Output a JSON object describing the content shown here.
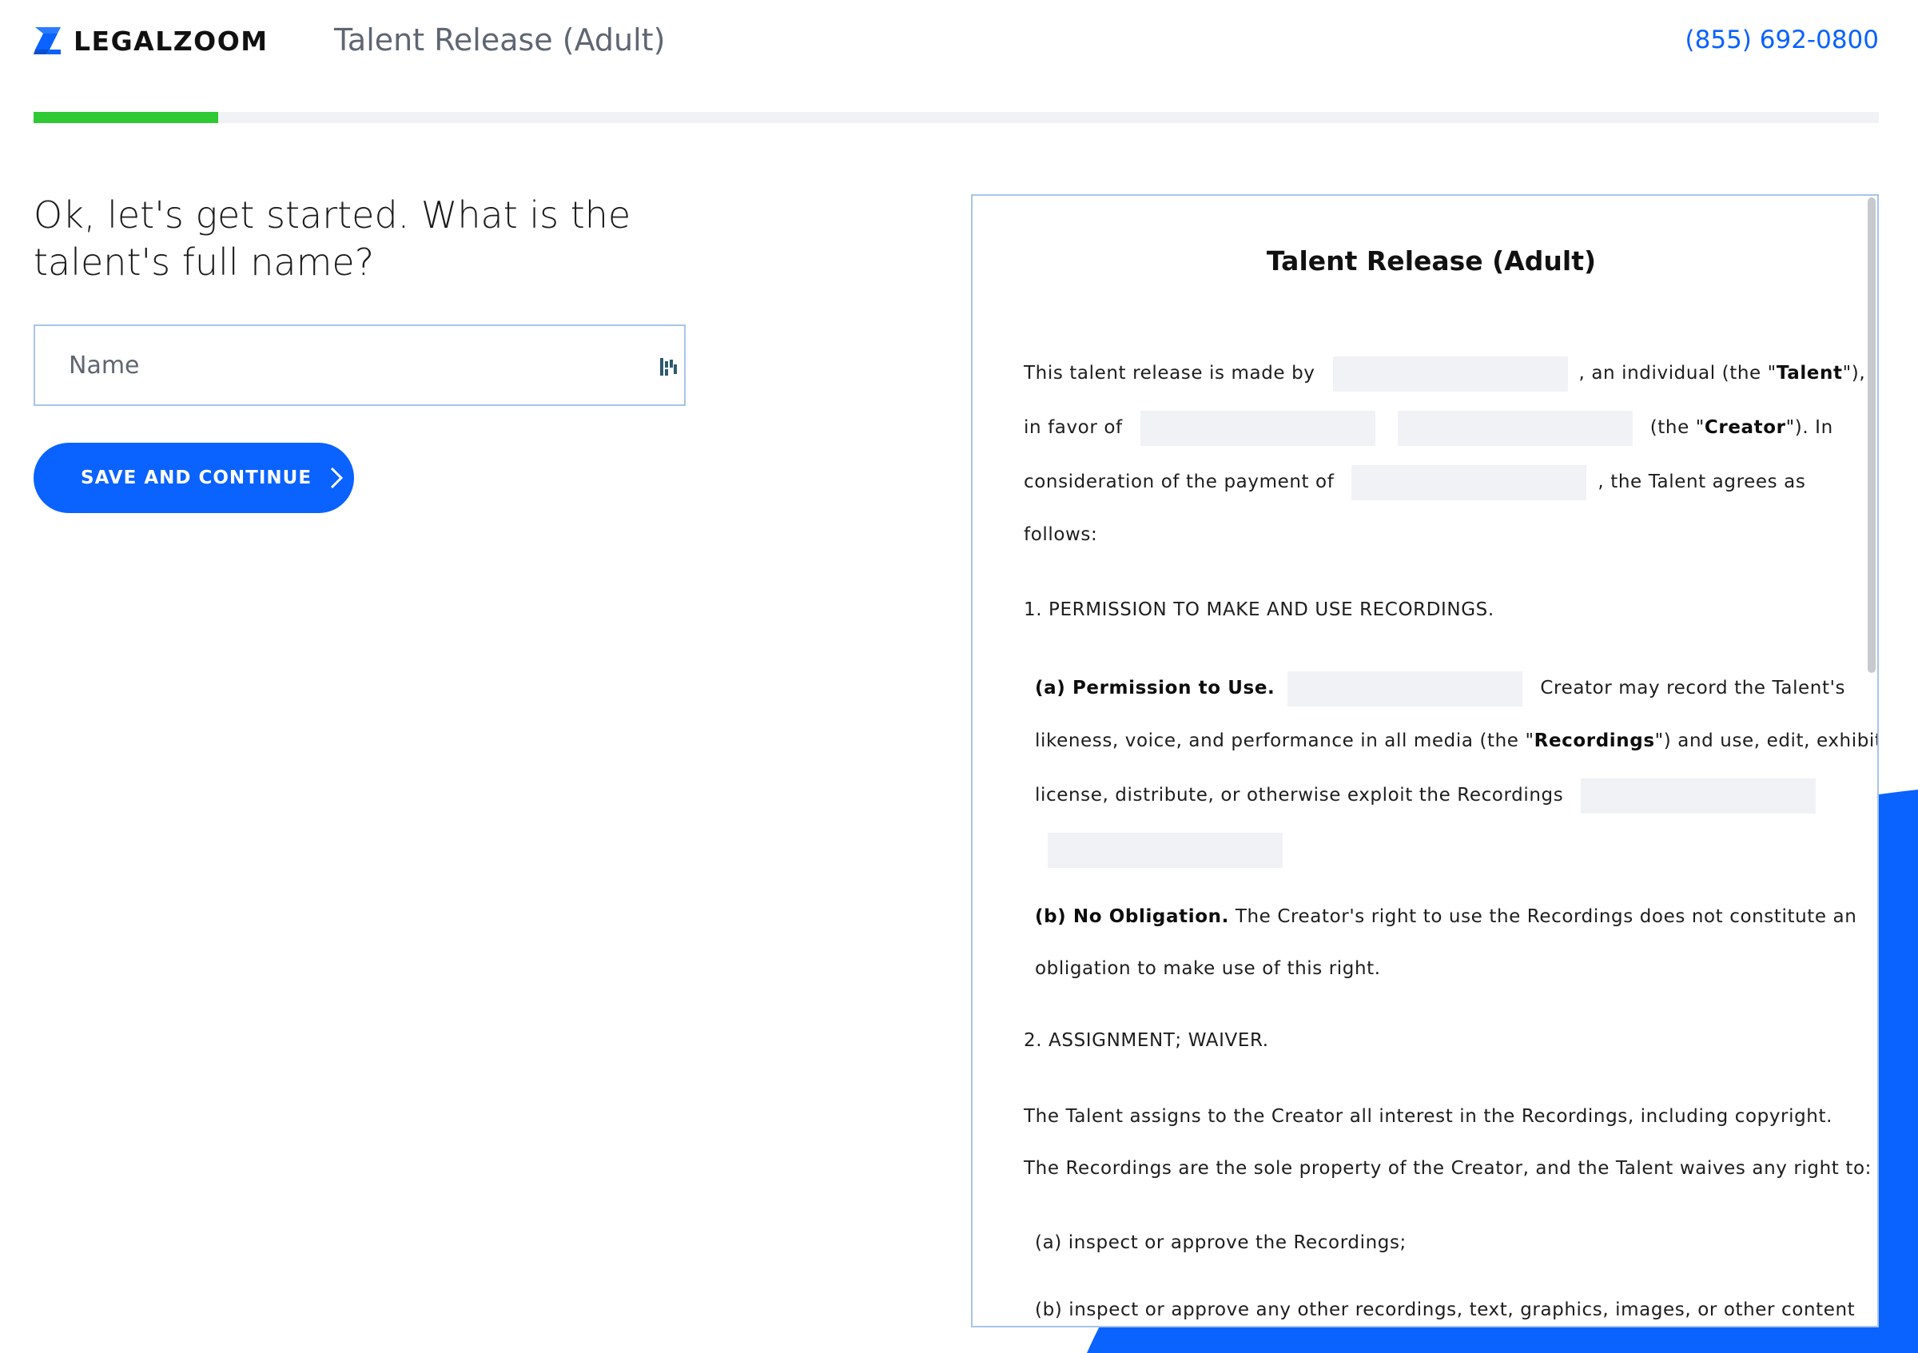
{
  "header": {
    "logo_text": "LEGALZOOM",
    "document_name": "Talent Release (Adult)",
    "phone": "(855) 692-0800"
  },
  "progress": {
    "percent": 10
  },
  "question": {
    "text": "Ok, let's get started. What is the talent's full name?",
    "input_placeholder": "Name",
    "input_value": ""
  },
  "actions": {
    "save_label": "SAVE AND CONTINUE"
  },
  "preview": {
    "title": "Talent Release (Adult)",
    "p1_l1_a": "This talent release is made by",
    "p1_l1_b": ", an individual (the \"",
    "p1_l1_c": "Talent",
    "p1_l1_d": "\"),",
    "p1_l2_a": "in favor of",
    "p1_l2_b": "(the \"",
    "p1_l2_c": "Creator",
    "p1_l2_d": "\"). In",
    "p1_l3_a": "consideration of the payment of",
    "p1_l3_b": ", the Talent agrees as",
    "p1_l4": "follows:",
    "s1_heading": "1. PERMISSION TO MAKE AND USE RECORDINGS.",
    "s1a_label": "(a) Permission to Use.",
    "s1a_l1_b": "Creator may record the Talent's",
    "s1a_l2_a": "likeness, voice, and performance in all media (the \"",
    "s1a_l2_b": "Recordings",
    "s1a_l2_c": "\") and use, edit, exhibit,",
    "s1a_l3": "license, distribute, or otherwise exploit the Recordings",
    "s1b_label": "(b) No Obligation.",
    "s1b_l1": "The Creator's right to use the Recordings does not constitute an",
    "s1b_l2": "obligation to make use of this right.",
    "s2_heading": "2. ASSIGNMENT; WAIVER.",
    "s2_l1": "The Talent assigns to the Creator all interest in the Recordings, including copyright.",
    "s2_l2": "The Recordings are the sole property of the Creator, and the Talent waives any right to:",
    "s2a": "(a) inspect or approve the Recordings;",
    "s2b": "(b) inspect or approve any other recordings, text, graphics, images, or other content"
  },
  "colors": {
    "brand_blue": "#0a62ff",
    "progress_green": "#2ec933",
    "blank_fill": "#f1f2f5",
    "border_blue": "#a8c4ea"
  },
  "icons": {
    "logo": "legalzoom-z-icon",
    "input_extension": "password-manager-icon",
    "button_chevron": "chevron-right-icon"
  }
}
